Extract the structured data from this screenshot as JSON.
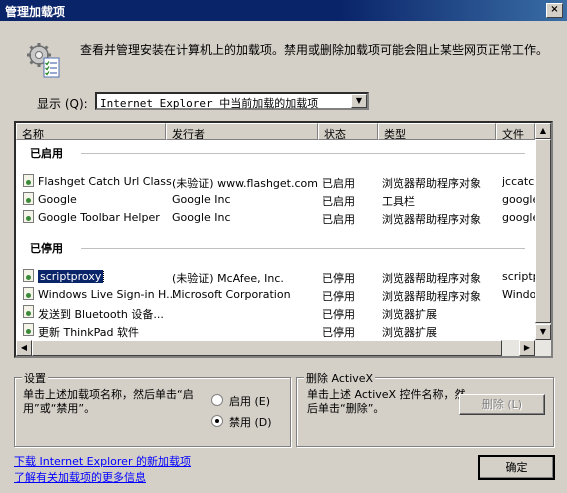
{
  "window": {
    "title": "管理加载项",
    "close_glyph": "×"
  },
  "intro_text": "查看并管理安装在计算机上的加载项。禁用或删除加载项可能会阻止某些网页正常工作。",
  "show": {
    "label": "显示 (Q):",
    "selected": "Internet Explorer 中当前加载的加载项"
  },
  "list": {
    "columns": [
      "名称",
      "发行者",
      "状态",
      "类型",
      "文件"
    ],
    "groups": [
      {
        "title": "已启用",
        "rows": [
          {
            "name": "Flashget Catch Url Class",
            "publisher": "(未验证) www.flashget.com",
            "status": "已启用",
            "type": "浏览器帮助程序对象",
            "file": "jccatch"
          },
          {
            "name": "Google",
            "publisher": "Google Inc",
            "status": "已启用",
            "type": "工具栏",
            "file": "googlet"
          },
          {
            "name": "Google Toolbar Helper",
            "publisher": "Google Inc",
            "status": "已启用",
            "type": "浏览器帮助程序对象",
            "file": "googlet"
          }
        ]
      },
      {
        "title": "已停用",
        "rows": [
          {
            "name": "scriptproxy",
            "publisher": "(未验证) McAfee, Inc.",
            "status": "已停用",
            "type": "浏览器帮助程序对象",
            "file": "scriptpr",
            "selected": true
          },
          {
            "name": "Windows Live Sign-in H...",
            "publisher": "Microsoft Corporation",
            "status": "已停用",
            "type": "浏览器帮助程序对象",
            "file": "Window"
          },
          {
            "name": "发送到 Bluetooth 设备...",
            "publisher": "",
            "status": "已停用",
            "type": "浏览器扩展",
            "file": ""
          },
          {
            "name": "更新 ThinkPad 软件",
            "publisher": "",
            "status": "已停用",
            "type": "浏览器扩展",
            "file": ""
          }
        ]
      }
    ]
  },
  "settings": {
    "legend": "设置",
    "text": "单击上述加载项名称，然后单击“启用”或“禁用”。",
    "enable_label": "启用 (E)",
    "disable_label": "禁用 (D)",
    "selected": "disable"
  },
  "delete_activex": {
    "legend": "删除 ActiveX",
    "text": "单击上述 ActiveX 控件名称，然后单击“删除”。",
    "button_label": "删除 (L)"
  },
  "links": {
    "download": "下载 Internet Explorer 的新加载项",
    "learn_more": "了解有关加载项的更多信息"
  },
  "ok_button": "确定"
}
